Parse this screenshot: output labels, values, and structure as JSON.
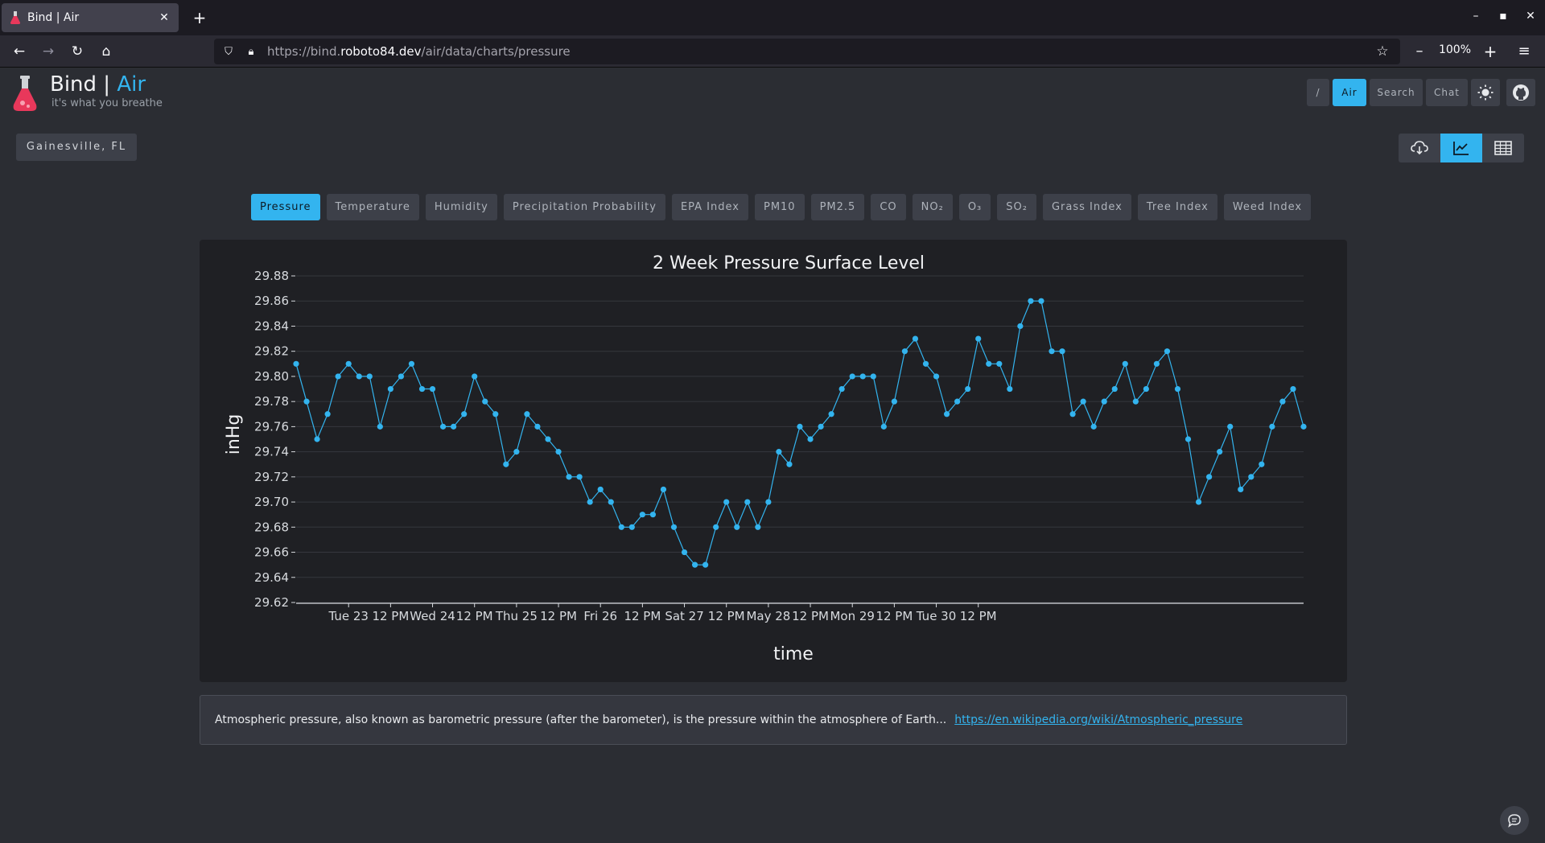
{
  "browser": {
    "tab_title": "Bind | Air",
    "tab_close": "✕",
    "new_tab": "+",
    "url_prefix": "https://bind.",
    "url_host": "roboto84.dev",
    "url_path": "/air/data/charts/pressure",
    "zoom": "100%",
    "minimize": "–",
    "maximize": "▪",
    "close": "✕"
  },
  "app": {
    "name": "Bind",
    "separator": " | ",
    "section": "Air",
    "tagline": "it's what you breathe",
    "nav": [
      {
        "label": "/"
      },
      {
        "label": "Air"
      },
      {
        "label": "Search"
      },
      {
        "label": "Chat"
      }
    ],
    "location": "Gainesville, FL",
    "accent_color": "#33b4ef"
  },
  "metric_tabs": [
    "Pressure",
    "Temperature",
    "Humidity",
    "Precipitation Probability",
    "EPA Index",
    "PM10",
    "PM2.5",
    "CO",
    "NO₂",
    "O₃",
    "SO₂",
    "Grass Index",
    "Tree Index",
    "Weed Index"
  ],
  "active_metric": "Pressure",
  "description": {
    "text": "Atmospheric pressure, also known as barometric pressure (after the barometer), is the pressure within the atmosphere of Earth...",
    "link": "https://en.wikipedia.org/wiki/Atmospheric_pressure"
  },
  "chart_data": {
    "type": "line",
    "title": "2 Week Pressure Surface Level",
    "xlabel": "time",
    "ylabel": "inHg",
    "ylim": [
      29.62,
      29.88
    ],
    "y_ticks": [
      "29.62",
      "29.64",
      "29.66",
      "29.68",
      "29.70",
      "29.72",
      "29.74",
      "29.76",
      "29.78",
      "29.80",
      "29.82",
      "29.84",
      "29.86",
      "29.88"
    ],
    "x_ticks": [
      "Tue 23",
      "12 PM",
      "Wed 24",
      "12 PM",
      "Thu 25",
      "12 PM",
      "Fri 26",
      "12 PM",
      "Sat 27",
      "12 PM",
      "May 28",
      "12 PM",
      "Mon 29",
      "12 PM",
      "Tue 30",
      "12 PM"
    ],
    "x_start": "2023-05-22T16:00",
    "x_interval_hours": 3,
    "grid": true,
    "line_color": "#33b4ef",
    "series": [
      {
        "values": [
          29.81,
          29.78,
          29.75,
          29.77,
          29.8,
          29.81,
          29.8,
          29.8,
          29.76,
          29.79,
          29.8,
          29.81,
          29.79,
          29.79,
          29.76,
          29.76,
          29.77,
          29.8,
          29.78,
          29.77,
          29.73,
          29.74,
          29.77,
          29.76,
          29.75,
          29.74,
          29.72,
          29.72,
          29.7,
          29.71,
          29.7,
          29.68,
          29.68,
          29.69,
          29.69,
          29.71,
          29.68,
          29.66,
          29.65,
          29.65,
          29.68,
          29.7,
          29.68,
          29.7,
          29.68,
          29.7,
          29.74,
          29.73,
          29.76,
          29.75,
          29.76,
          29.77,
          29.79,
          29.8,
          29.8,
          29.8,
          29.76,
          29.78,
          29.82,
          29.83,
          29.81,
          29.8,
          29.77,
          29.78,
          29.79,
          29.83,
          29.81,
          29.81,
          29.79,
          29.84,
          29.86,
          29.86,
          29.82,
          29.82,
          29.77,
          29.78,
          29.76,
          29.78,
          29.79,
          29.81,
          29.78,
          29.79,
          29.81,
          29.82,
          29.79,
          29.75,
          29.7,
          29.72,
          29.74,
          29.76,
          29.71,
          29.72,
          29.73,
          29.76,
          29.78,
          29.79,
          29.76
        ]
      }
    ]
  }
}
